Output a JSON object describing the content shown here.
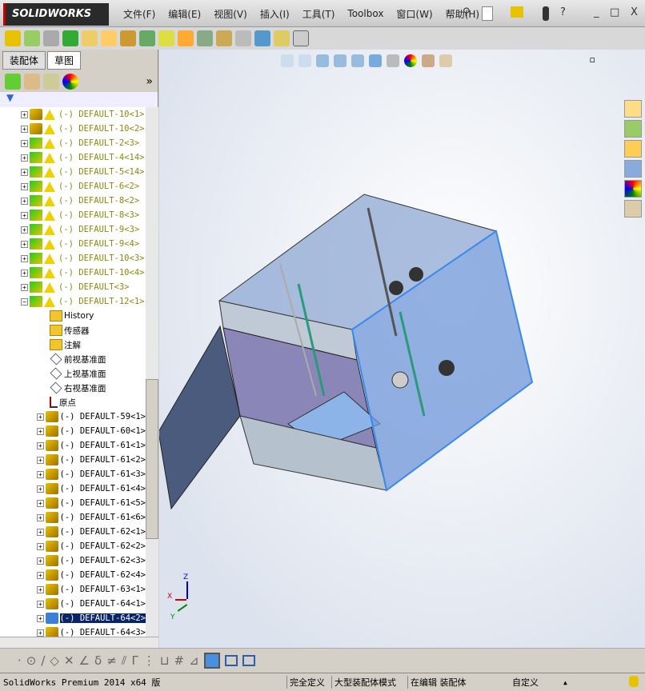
{
  "app": {
    "logo": "SOLIDWORKS",
    "menu": [
      "文件(F)",
      "编辑(E)",
      "视图(V)",
      "插入(I)",
      "工具(T)",
      "Toolbox",
      "窗口(W)",
      "帮助(H)"
    ],
    "window_controls": [
      "_",
      "□",
      "X"
    ]
  },
  "left_panel": {
    "tabs": [
      "装配体",
      "草图"
    ],
    "expand_label": "»",
    "tree": [
      {
        "label": "(-) DEFAULT-10<1>",
        "type": "part-warn"
      },
      {
        "label": "(-) DEFAULT-10<2>",
        "type": "part-warn"
      },
      {
        "label": "(-) DEFAULT-2<3>",
        "type": "asm-warn"
      },
      {
        "label": "(-) DEFAULT-4<14>",
        "type": "asm-warn"
      },
      {
        "label": "(-) DEFAULT-5<14>",
        "type": "asm-warn"
      },
      {
        "label": "(-) DEFAULT-6<2>",
        "type": "asm-warn"
      },
      {
        "label": "(-) DEFAULT-8<2>",
        "type": "asm-warn"
      },
      {
        "label": "(-) DEFAULT-8<3>",
        "type": "asm-warn"
      },
      {
        "label": "(-) DEFAULT-9<3>",
        "type": "asm-warn"
      },
      {
        "label": "(-) DEFAULT-9<4>",
        "type": "asm-warn"
      },
      {
        "label": "(-) DEFAULT-10<3>",
        "type": "asm-warn"
      },
      {
        "label": "(-) DEFAULT-10<4>",
        "type": "asm-warn"
      },
      {
        "label": "(-) DEFAULT<3> ",
        "type": "asm-warn"
      },
      {
        "label": "(-) DEFAULT-12<1>",
        "type": "asm-warn-open"
      },
      {
        "label": "History",
        "type": "child"
      },
      {
        "label": "传感器",
        "type": "child"
      },
      {
        "label": "注解",
        "type": "child"
      },
      {
        "label": "前视基准面",
        "type": "plane"
      },
      {
        "label": "上视基准面",
        "type": "plane"
      },
      {
        "label": "右视基准面",
        "type": "plane"
      },
      {
        "label": "原点",
        "type": "origin"
      },
      {
        "label": "(-) DEFAULT-59<1>",
        "type": "part"
      },
      {
        "label": "(-) DEFAULT-60<1>",
        "type": "part"
      },
      {
        "label": "(-) DEFAULT-61<1>",
        "type": "part"
      },
      {
        "label": "(-) DEFAULT-61<2>",
        "type": "part"
      },
      {
        "label": "(-) DEFAULT-61<3>",
        "type": "part"
      },
      {
        "label": "(-) DEFAULT-61<4>",
        "type": "part"
      },
      {
        "label": "(-) DEFAULT-61<5>",
        "type": "part"
      },
      {
        "label": "(-) DEFAULT-61<6>",
        "type": "part"
      },
      {
        "label": "(-) DEFAULT-62<1>",
        "type": "part"
      },
      {
        "label": "(-) DEFAULT-62<2>",
        "type": "part"
      },
      {
        "label": "(-) DEFAULT-62<3>",
        "type": "part"
      },
      {
        "label": "(-) DEFAULT-62<4>",
        "type": "part"
      },
      {
        "label": "(-) DEFAULT-63<1>",
        "type": "part"
      },
      {
        "label": "(-) DEFAULT-64<1>",
        "type": "part"
      },
      {
        "label": "(-) DEFAULT-64<2>",
        "type": "part-selected"
      },
      {
        "label": "(-) DEFAULT-64<3>",
        "type": "part"
      }
    ]
  },
  "triad": {
    "x": "X",
    "y": "Y",
    "z": "Z"
  },
  "status": {
    "product": "SolidWorks Premium 2014 x64 版",
    "fully_defined": "完全定义",
    "large_asm": "大型装配体模式",
    "editing": "在编辑 装配体",
    "custom": "自定义",
    "custom_arrow": "▲"
  },
  "colors": {
    "selection": "#0a246a",
    "tree_text": "#8a8a10",
    "glass": "#7fa0d8"
  }
}
